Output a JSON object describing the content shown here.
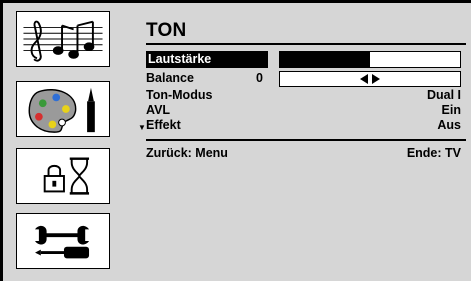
{
  "menu": {
    "title": "TON",
    "items": [
      {
        "label": "Lautstärke",
        "level": 0.5
      },
      {
        "label": "Balance",
        "number": "0"
      },
      {
        "label": "Ton-Modus",
        "value": "Dual I"
      },
      {
        "label": "AVL",
        "value": "Ein"
      },
      {
        "label": "Effekt",
        "value": "Aus"
      }
    ]
  },
  "footer": {
    "back": "Zurück: Menu",
    "end": "Ende: TV"
  },
  "sidebar": {
    "icons": [
      "music-notes-icon",
      "paint-palette-icon",
      "lock-timer-icon",
      "tools-icon"
    ]
  },
  "colors": {
    "panel": "#d6d6d6",
    "highlight": "#000000",
    "text": "#000000"
  }
}
